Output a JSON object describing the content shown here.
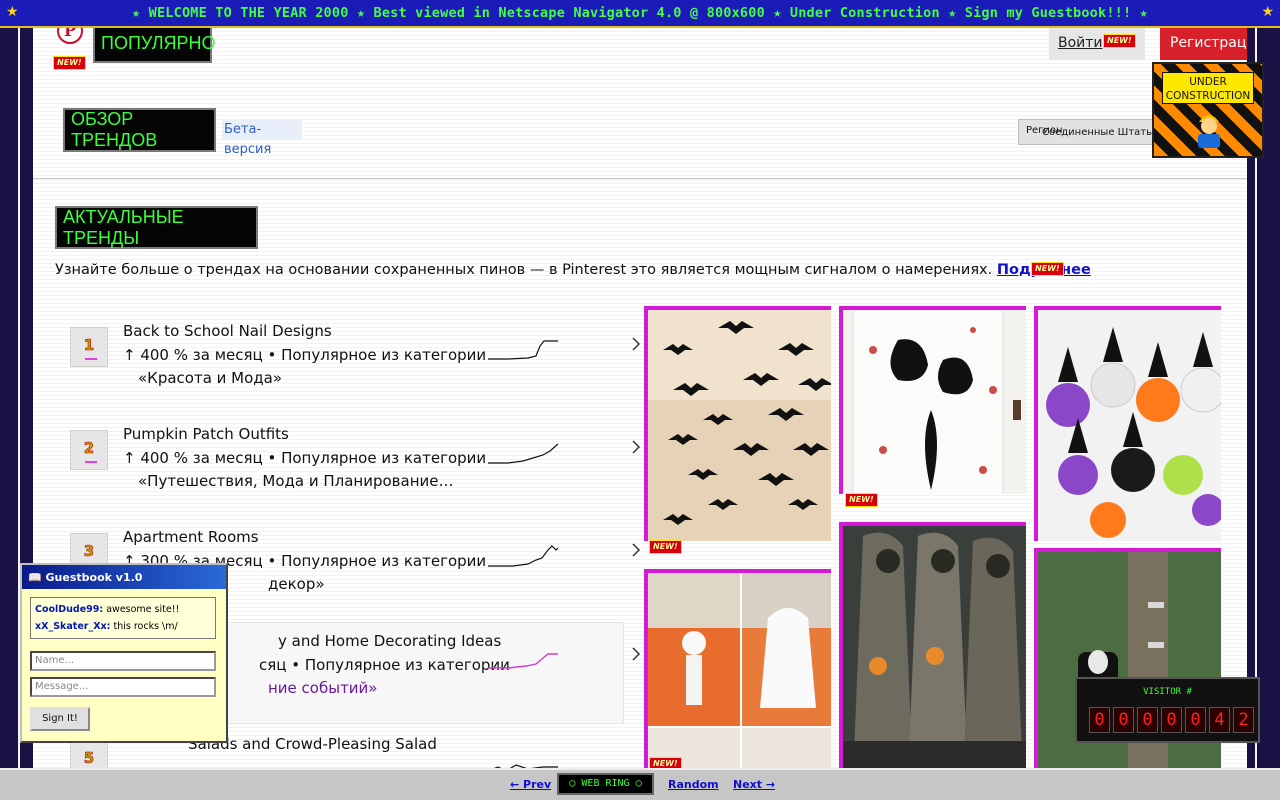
{
  "marquee": {
    "text": "★ WELCOME TO THE YEAR 2000 ★ Best viewed in Netscape Navigator 4.0 @ 800x600 ★ Under Construction ★ Sign my Guestbook!!! ★",
    "star": "★"
  },
  "header": {
    "logo_glyph": "P",
    "popular": "ПОПУЛЯРНО",
    "new_badge": "NEW!",
    "login": "Войти",
    "signup": "Регистрация"
  },
  "overview": {
    "title": "ОБЗОР ТРЕНДОВ",
    "beta": "Бета-версия",
    "region_label": "Регион",
    "region_value": "Соединенные Штаты Америки"
  },
  "trends_section": {
    "title": "АКТУАЛЬНЫЕ ТРЕНДЫ",
    "intro": "Узнайте больше о трендах на основании сохраненных пинов — в Pinterest это является мощным сигналом о намерениях.",
    "learn_more": "Подробнее"
  },
  "trends": [
    {
      "rank": "1",
      "title": "Back to School Nail Designs",
      "stat": "↑ 400 % за месяц • Популярное из категории",
      "category": "«Красота и Мода»"
    },
    {
      "rank": "2",
      "title": "Pumpkin Patch Outfits",
      "stat": "↑ 400 % за месяц • Популярное из категории",
      "category": "«Путешествия, Мода и Планирование…"
    },
    {
      "rank": "3",
      "title": "Apartment Rooms",
      "stat": "↑ 300 % за месяц • Популярное из категории",
      "category": "декор»"
    },
    {
      "rank": "4",
      "title": "y and Home Decorating Ideas",
      "stat": "сяц • Популярное из категории",
      "category": "ние событий»"
    },
    {
      "rank": "5",
      "title": "Salads and Crowd-Pleasing Salad",
      "stat": "",
      "category": ""
    }
  ],
  "construction": {
    "line1": "UNDER",
    "line2": "CONSTRUCTION"
  },
  "guestbook": {
    "title": "📖 Guestbook v1.0",
    "messages": [
      {
        "user": "CoolDude99:",
        "text": "awesome site!!"
      },
      {
        "user": "xX_Skater_Xx:",
        "text": "this rocks \\m/"
      }
    ],
    "name_placeholder": "Name...",
    "message_placeholder": "Message...",
    "submit": "Sign It!"
  },
  "counter": {
    "label": "VISITOR #",
    "digits": [
      "0",
      "0",
      "0",
      "0",
      "0",
      "4",
      "2"
    ]
  },
  "webring": {
    "prev": "← Prev",
    "ring": "◯ WEB RING ◯",
    "random": "Random",
    "next": "Next →"
  },
  "colors": {
    "accent_magenta": "#d41ad4",
    "neon_green": "#3bff3b",
    "pinterest_red": "#d8202a"
  }
}
